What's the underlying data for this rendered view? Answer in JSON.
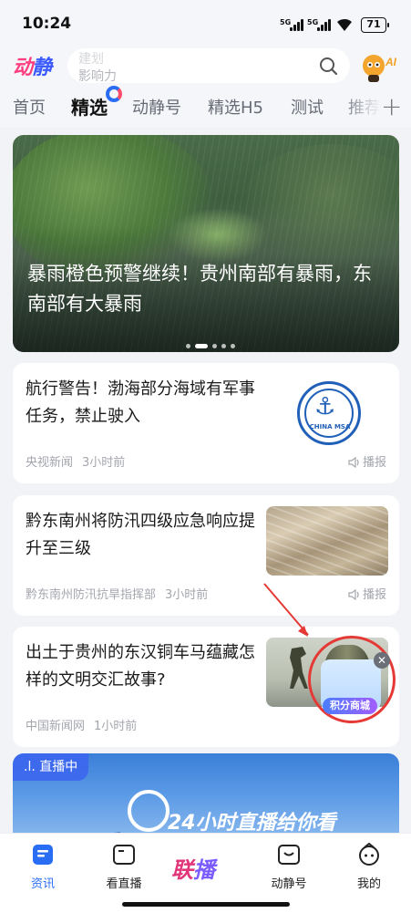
{
  "status_bar": {
    "time": "10:24",
    "net1": "5G",
    "net2": "5G",
    "battery": "71"
  },
  "header": {
    "logo_a": "动",
    "logo_b": "静",
    "search_placeholder_line1": "建划",
    "search_placeholder_line2": "影响力",
    "ai_label": "AI"
  },
  "tabs": [
    {
      "label": "首页"
    },
    {
      "label": "精选"
    },
    {
      "label": "动静号"
    },
    {
      "label": "精选H5"
    },
    {
      "label": "测试"
    },
    {
      "label": "推荐"
    }
  ],
  "hero": {
    "title": "暴雨橙色预警继续！贵州南部有暴雨，东南部有大暴雨"
  },
  "news": [
    {
      "title": "航行警告！渤海部分海域有军事任务，禁止驶入",
      "source": "央视新闻",
      "time": "3小时前",
      "broadcast": "播报",
      "thumb_text": "CHINA MSA"
    },
    {
      "title": "黔东南州将防汛四级应急响应提升至三级",
      "source": "黔东南州防汛抗旱指挥部",
      "time": "3小时前",
      "broadcast": "播报"
    },
    {
      "title": "出土于贵州的东汉铜车马蕴藏怎样的文明交汇故事?",
      "source": "中国新闻网",
      "time": "1小时前"
    }
  ],
  "floating": {
    "label": "积分商城",
    "close": "✕"
  },
  "live": {
    "badge": ".l. 直播中",
    "slogan": "24小时直播给你看"
  },
  "bottom_nav": [
    {
      "label": "资讯",
      "icon": "news-icon"
    },
    {
      "label": "看直播",
      "icon": "tv-icon"
    },
    {
      "label": "联播",
      "icon": "lianbo-logo"
    },
    {
      "label": "动静号",
      "icon": "chat-icon"
    },
    {
      "label": "我的",
      "icon": "profile-icon"
    }
  ],
  "colors": {
    "accent": "#2a6df5",
    "brand_pink": "#e2367a",
    "highlight_red": "#e53935"
  }
}
